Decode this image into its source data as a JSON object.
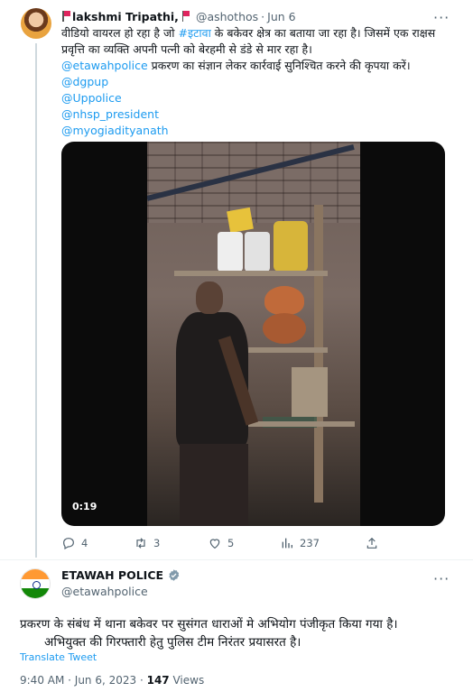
{
  "tweet1": {
    "name": "lakshmi Tripathi,",
    "handle": "@ashothos",
    "separator": "·",
    "date": "Jun 6",
    "more": "···",
    "text": {
      "line1_prefix": "वीडियो वायरल हो रहा है जो ",
      "hashtag": "#इटावा",
      "line1_suffix": " के बकेवर क्षेत्र का बताया जा रहा है। जिसमें एक राक्षस",
      "line2": "प्रवृत्ति का व्यक्ति अपनी पत्नी को बेरहमी से डंडे से मार रहा है।",
      "mention_etawah": "@etawahpolice",
      "line3_suffix": " प्रकरण का संज्ञान लेकर कार्रवाई सुनिश्चित करने की कृपया करें।",
      "mentions": [
        "@dgpup",
        "@Uppolice",
        "@nhsp_president",
        "@myogiadityanath"
      ]
    },
    "video": {
      "duration": "0:19"
    },
    "actions": {
      "replies": "4",
      "retweets": "3",
      "likes": "5",
      "views": "237"
    }
  },
  "tweet2": {
    "name": "ETAWAH POLICE",
    "handle": "@etawahpolice",
    "more": "···",
    "text": {
      "line1": "प्रकरण के संबंध में थाना बकेवर पर सुसंगत धाराओं मे अभियोग पंजीकृत किया गया है।",
      "line2": "अभियुक्त की गिरफ्तारी हेतु पुलिस टीम निरंतर प्रयासरत है।"
    },
    "translate_label": "Translate Tweet",
    "meta": {
      "time": "9:40 AM",
      "separator1": " · ",
      "date": "Jun 6, 2023",
      "separator2": " · ",
      "views_count": "147",
      "views_label": " Views"
    }
  },
  "colors": {
    "link": "#1d9bf0",
    "secondary_text": "#536471",
    "verified_badge": "#829aab",
    "flag_red": "#e0245e"
  },
  "icons": [
    "reply-icon",
    "retweet-icon",
    "like-icon",
    "views-icon",
    "share-icon",
    "verified-icon",
    "more-icon",
    "flag-icon"
  ]
}
